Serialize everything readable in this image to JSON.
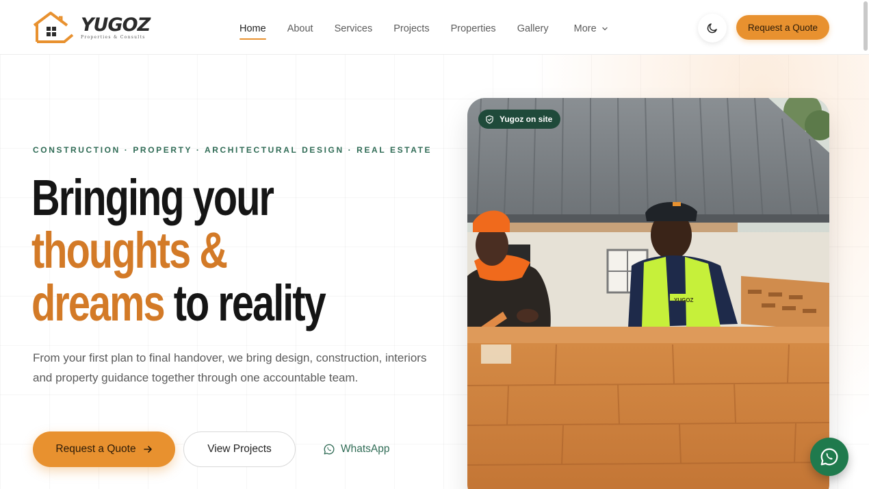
{
  "brand": {
    "name": "YUGOZ",
    "tagline": "Properties & Consults"
  },
  "nav": {
    "items": [
      {
        "label": "Home",
        "active": true
      },
      {
        "label": "About"
      },
      {
        "label": "Services"
      },
      {
        "label": "Projects"
      },
      {
        "label": "Properties"
      },
      {
        "label": "Gallery"
      }
    ],
    "more_label": "More"
  },
  "header": {
    "theme_toggle_icon": "moon-icon",
    "quote_button": "Request a Quote"
  },
  "hero": {
    "eyebrow": "CONSTRUCTION · PROPERTY · ARCHITECTURAL DESIGN · REAL ESTATE",
    "headline": {
      "line1": "Bringing your",
      "line2": "thoughts &",
      "line3_accent": "dreams",
      "line3_rest": " to reality"
    },
    "lead": "From your first plan to final handover, we bring design, construction, interiors and property guidance together through one accountable team.",
    "cta_primary": "Request a Quote",
    "cta_secondary": "View Projects",
    "cta_whatsapp": "WhatsApp",
    "photo_badge": "Yugoz on site",
    "vest_text": "YUGOZ"
  },
  "colors": {
    "accent": "#e8912f",
    "accent_dark": "#d37a27",
    "green": "#2f6b55",
    "badge_bg": "#1f4a3a",
    "whatsapp": "#1f7a4d"
  }
}
